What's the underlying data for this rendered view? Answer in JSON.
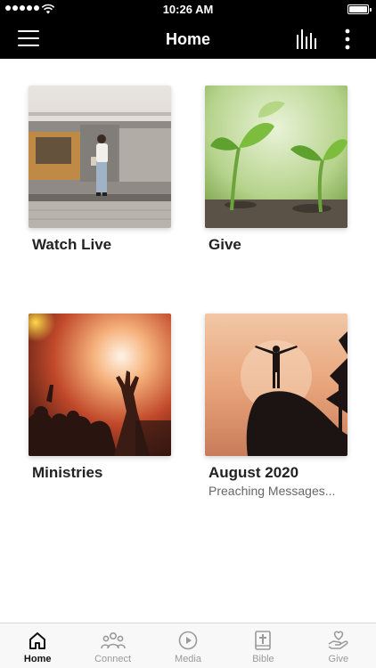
{
  "status_bar": {
    "time": "10:26 AM"
  },
  "header": {
    "title": "Home"
  },
  "tiles": [
    {
      "label": "Watch Live",
      "image": "train-platform-photo"
    },
    {
      "label": "Give",
      "image": "seedlings-photo"
    },
    {
      "label": "Ministries",
      "image": "concert-crowd-photo"
    },
    {
      "label": "August 2020",
      "sublabel": "Preaching Messages...",
      "image": "silhouette-rock-sunset-photo"
    }
  ],
  "tab_bar": {
    "active": "Home",
    "items": [
      {
        "label": "Home",
        "icon": "home-icon"
      },
      {
        "label": "Connect",
        "icon": "people-icon"
      },
      {
        "label": "Media",
        "icon": "play-circle-icon"
      },
      {
        "label": "Bible",
        "icon": "bible-icon"
      },
      {
        "label": "Give",
        "icon": "hand-heart-icon"
      }
    ]
  },
  "colors": {
    "nav_background": "#000000",
    "tab_active": "#111111",
    "tab_inactive": "#9a9a9a"
  }
}
